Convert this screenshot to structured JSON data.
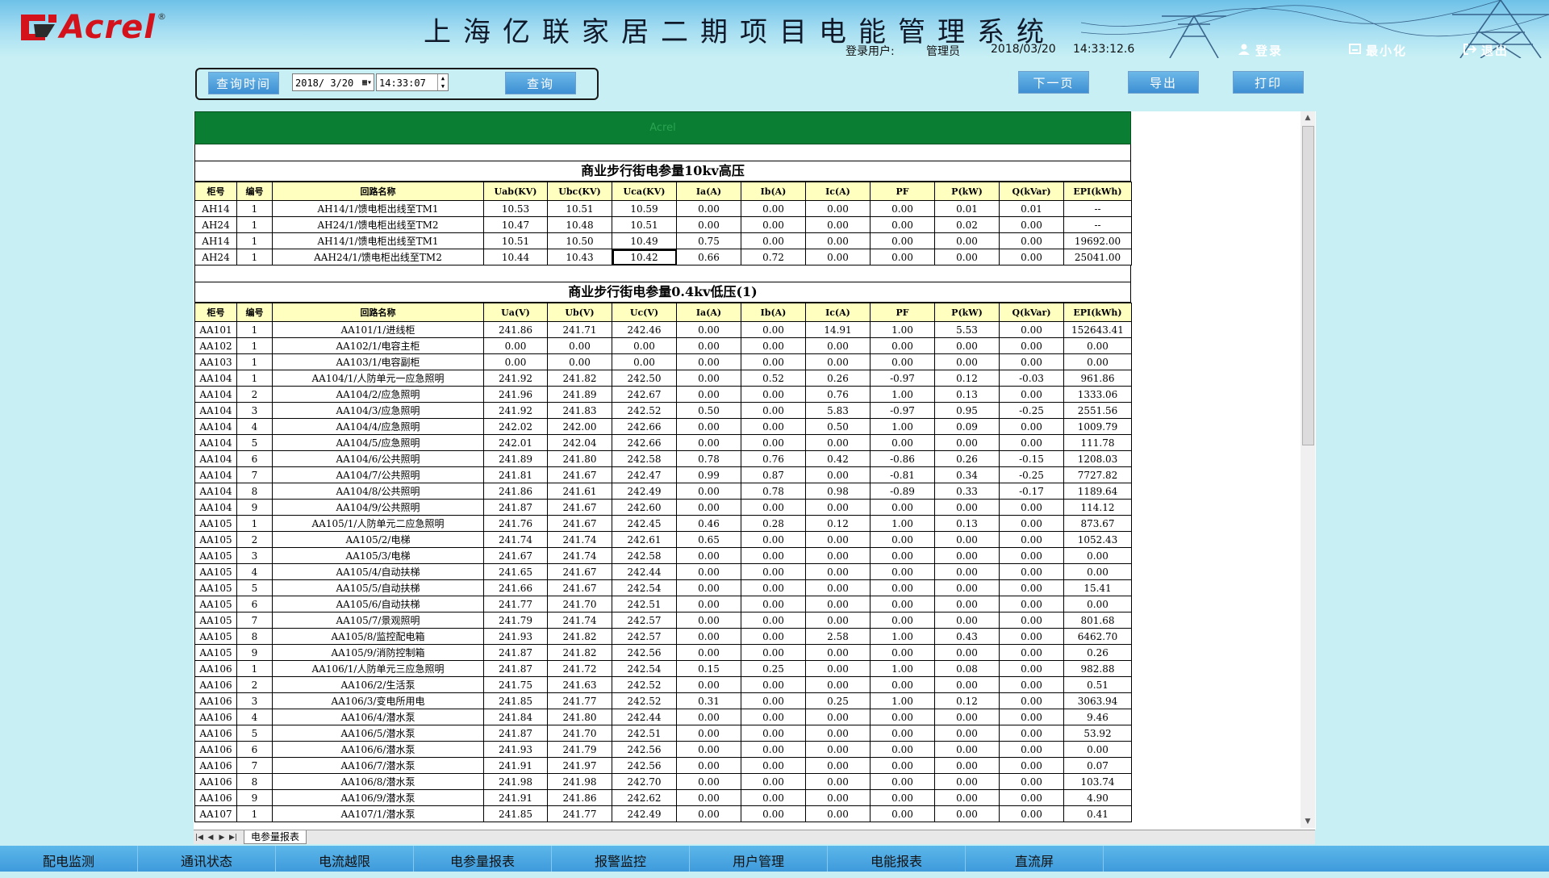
{
  "header": {
    "brand": "Acrel",
    "brand_mark": "®",
    "title": "上海亿联家居二期项目电能管理系统",
    "login_label": "登录用户:",
    "user": "管理员",
    "date": "2018/03/20",
    "time": "14:33:12.6",
    "buttons": {
      "login": "登录",
      "minimize": "最小化",
      "exit": "退出"
    }
  },
  "toolbar": {
    "query_time_label": "查询时间",
    "date_value": "2018/ 3/20",
    "time_value": "14:33:07",
    "query_button": "查询",
    "next_page_button": "下一页",
    "export_button": "导出",
    "print_button": "打印"
  },
  "report": {
    "banner_text": "Acrel",
    "hv_title": "商业步行街电参量10kv高压",
    "hv_columns": [
      "柜号",
      "编号",
      "回路名称",
      "Uab(KV)",
      "Ubc(KV)",
      "Uca(KV)",
      "Ia(A)",
      "Ib(A)",
      "Ic(A)",
      "PF",
      "P(kW)",
      "Q(kVar)",
      "EPI(kWh)"
    ],
    "hv_rows": [
      [
        "AH14",
        "1",
        "AH14/1/馈电柜出线至TM1",
        "10.53",
        "10.51",
        "10.59",
        "0.00",
        "0.00",
        "0.00",
        "0.00",
        "0.01",
        "0.01",
        "--"
      ],
      [
        "AH24",
        "1",
        "AH24/1/馈电柜出线至TM2",
        "10.47",
        "10.48",
        "10.51",
        "0.00",
        "0.00",
        "0.00",
        "0.00",
        "0.02",
        "0.00",
        "--"
      ],
      [
        "AH14",
        "1",
        "AH14/1/馈电柜出线至TM1",
        "10.51",
        "10.50",
        "10.49",
        "0.75",
        "0.00",
        "0.00",
        "0.00",
        "0.00",
        "0.00",
        "19692.00"
      ],
      [
        "AH24",
        "1",
        "AAH24/1/馈电柜出线至TM2",
        "10.44",
        "10.43",
        "10.42",
        "0.66",
        "0.72",
        "0.00",
        "0.00",
        "0.00",
        "0.00",
        "25041.00"
      ]
    ],
    "lv_title": "商业步行街电参量0.4kv低压(1)",
    "lv_columns": [
      "柜号",
      "编号",
      "回路名称",
      "Ua(V)",
      "Ub(V)",
      "Uc(V)",
      "Ia(A)",
      "Ib(A)",
      "Ic(A)",
      "PF",
      "P(kW)",
      "Q(kVar)",
      "EPI(kWh)"
    ],
    "lv_rows": [
      [
        "AA101",
        "1",
        "AA101/1/进线柜",
        "241.86",
        "241.71",
        "242.46",
        "0.00",
        "0.00",
        "14.91",
        "1.00",
        "5.53",
        "0.00",
        "152643.41"
      ],
      [
        "AA102",
        "1",
        "AA102/1/电容主柜",
        "0.00",
        "0.00",
        "0.00",
        "0.00",
        "0.00",
        "0.00",
        "0.00",
        "0.00",
        "0.00",
        "0.00"
      ],
      [
        "AA103",
        "1",
        "AA103/1/电容副柜",
        "0.00",
        "0.00",
        "0.00",
        "0.00",
        "0.00",
        "0.00",
        "0.00",
        "0.00",
        "0.00",
        "0.00"
      ],
      [
        "AA104",
        "1",
        "AA104/1/人防单元一应急照明",
        "241.92",
        "241.82",
        "242.50",
        "0.00",
        "0.52",
        "0.26",
        "-0.97",
        "0.12",
        "-0.03",
        "961.86"
      ],
      [
        "AA104",
        "2",
        "AA104/2/应急照明",
        "241.96",
        "241.89",
        "242.67",
        "0.00",
        "0.00",
        "0.76",
        "1.00",
        "0.13",
        "0.00",
        "1333.06"
      ],
      [
        "AA104",
        "3",
        "AA104/3/应急照明",
        "241.92",
        "241.83",
        "242.52",
        "0.50",
        "0.00",
        "5.83",
        "-0.97",
        "0.95",
        "-0.25",
        "2551.56"
      ],
      [
        "AA104",
        "4",
        "AA104/4/应急照明",
        "242.02",
        "242.00",
        "242.66",
        "0.00",
        "0.00",
        "0.50",
        "1.00",
        "0.09",
        "0.00",
        "1009.79"
      ],
      [
        "AA104",
        "5",
        "AA104/5/应急照明",
        "242.01",
        "242.04",
        "242.66",
        "0.00",
        "0.00",
        "0.00",
        "0.00",
        "0.00",
        "0.00",
        "111.78"
      ],
      [
        "AA104",
        "6",
        "AA104/6/公共照明",
        "241.89",
        "241.80",
        "242.58",
        "0.78",
        "0.76",
        "0.42",
        "-0.86",
        "0.26",
        "-0.15",
        "1208.03"
      ],
      [
        "AA104",
        "7",
        "AA104/7/公共照明",
        "241.81",
        "241.67",
        "242.47",
        "0.99",
        "0.87",
        "0.00",
        "-0.81",
        "0.34",
        "-0.25",
        "7727.82"
      ],
      [
        "AA104",
        "8",
        "AA104/8/公共照明",
        "241.86",
        "241.61",
        "242.49",
        "0.00",
        "0.78",
        "0.98",
        "-0.89",
        "0.33",
        "-0.17",
        "1189.64"
      ],
      [
        "AA104",
        "9",
        "AA104/9/公共照明",
        "241.87",
        "241.67",
        "242.60",
        "0.00",
        "0.00",
        "0.00",
        "0.00",
        "0.00",
        "0.00",
        "114.12"
      ],
      [
        "AA105",
        "1",
        "AA105/1/人防单元二应急照明",
        "241.76",
        "241.67",
        "242.45",
        "0.46",
        "0.28",
        "0.12",
        "1.00",
        "0.13",
        "0.00",
        "873.67"
      ],
      [
        "AA105",
        "2",
        "AA105/2/电梯",
        "241.74",
        "241.74",
        "242.61",
        "0.65",
        "0.00",
        "0.00",
        "0.00",
        "0.00",
        "0.00",
        "1052.43"
      ],
      [
        "AA105",
        "3",
        "AA105/3/电梯",
        "241.67",
        "241.74",
        "242.58",
        "0.00",
        "0.00",
        "0.00",
        "0.00",
        "0.00",
        "0.00",
        "0.00"
      ],
      [
        "AA105",
        "4",
        "AA105/4/自动扶梯",
        "241.65",
        "241.67",
        "242.44",
        "0.00",
        "0.00",
        "0.00",
        "0.00",
        "0.00",
        "0.00",
        "0.00"
      ],
      [
        "AA105",
        "5",
        "AA105/5/自动扶梯",
        "241.66",
        "241.67",
        "242.54",
        "0.00",
        "0.00",
        "0.00",
        "0.00",
        "0.00",
        "0.00",
        "15.41"
      ],
      [
        "AA105",
        "6",
        "AA105/6/自动扶梯",
        "241.77",
        "241.70",
        "242.51",
        "0.00",
        "0.00",
        "0.00",
        "0.00",
        "0.00",
        "0.00",
        "0.00"
      ],
      [
        "AA105",
        "7",
        "AA105/7/景观照明",
        "241.79",
        "241.74",
        "242.57",
        "0.00",
        "0.00",
        "0.00",
        "0.00",
        "0.00",
        "0.00",
        "801.68"
      ],
      [
        "AA105",
        "8",
        "AA105/8/监控配电箱",
        "241.93",
        "241.82",
        "242.57",
        "0.00",
        "0.00",
        "2.58",
        "1.00",
        "0.43",
        "0.00",
        "6462.70"
      ],
      [
        "AA105",
        "9",
        "AA105/9/消防控制箱",
        "241.87",
        "241.82",
        "242.56",
        "0.00",
        "0.00",
        "0.00",
        "0.00",
        "0.00",
        "0.00",
        "0.26"
      ],
      [
        "AA106",
        "1",
        "AA106/1/人防单元三应急照明",
        "241.87",
        "241.72",
        "242.54",
        "0.15",
        "0.25",
        "0.00",
        "1.00",
        "0.08",
        "0.00",
        "982.88"
      ],
      [
        "AA106",
        "2",
        "AA106/2/生活泵",
        "241.75",
        "241.63",
        "242.52",
        "0.00",
        "0.00",
        "0.00",
        "0.00",
        "0.00",
        "0.00",
        "0.51"
      ],
      [
        "AA106",
        "3",
        "AA106/3/变电所用电",
        "241.85",
        "241.77",
        "242.52",
        "0.31",
        "0.00",
        "0.25",
        "1.00",
        "0.12",
        "0.00",
        "3063.94"
      ],
      [
        "AA106",
        "4",
        "AA106/4/潜水泵",
        "241.84",
        "241.80",
        "242.44",
        "0.00",
        "0.00",
        "0.00",
        "0.00",
        "0.00",
        "0.00",
        "9.46"
      ],
      [
        "AA106",
        "5",
        "AA106/5/潜水泵",
        "241.87",
        "241.70",
        "242.51",
        "0.00",
        "0.00",
        "0.00",
        "0.00",
        "0.00",
        "0.00",
        "53.92"
      ],
      [
        "AA106",
        "6",
        "AA106/6/潜水泵",
        "241.93",
        "241.79",
        "242.56",
        "0.00",
        "0.00",
        "0.00",
        "0.00",
        "0.00",
        "0.00",
        "0.00"
      ],
      [
        "AA106",
        "7",
        "AA106/7/潜水泵",
        "241.91",
        "241.97",
        "242.56",
        "0.00",
        "0.00",
        "0.00",
        "0.00",
        "0.00",
        "0.00",
        "0.07"
      ],
      [
        "AA106",
        "8",
        "AA106/8/潜水泵",
        "241.98",
        "241.98",
        "242.70",
        "0.00",
        "0.00",
        "0.00",
        "0.00",
        "0.00",
        "0.00",
        "103.74"
      ],
      [
        "AA106",
        "9",
        "AA106/9/潜水泵",
        "241.91",
        "241.86",
        "242.62",
        "0.00",
        "0.00",
        "0.00",
        "0.00",
        "0.00",
        "0.00",
        "4.90"
      ],
      [
        "AA107",
        "1",
        "AA107/1/潜水泵",
        "241.85",
        "241.77",
        "242.49",
        "0.00",
        "0.00",
        "0.00",
        "0.00",
        "0.00",
        "0.00",
        "0.41"
      ]
    ],
    "sheet_tab": "电参量报表"
  },
  "nav": [
    "配电监测",
    "通讯状态",
    "电流越限",
    "电参量报表",
    "报警监控",
    "用户管理",
    "电能报表",
    "直流屏"
  ],
  "colors": {
    "header_band": "#6ec1e8",
    "banner_green": "#0a7f33",
    "table_header": "#ffffc0",
    "logo_red": "#d3121b"
  },
  "icons": {
    "login": "user-icon",
    "minimize": "minimize-icon",
    "exit": "exit-icon",
    "calendar": "calendar-icon",
    "spinner": "spinner-icon"
  }
}
